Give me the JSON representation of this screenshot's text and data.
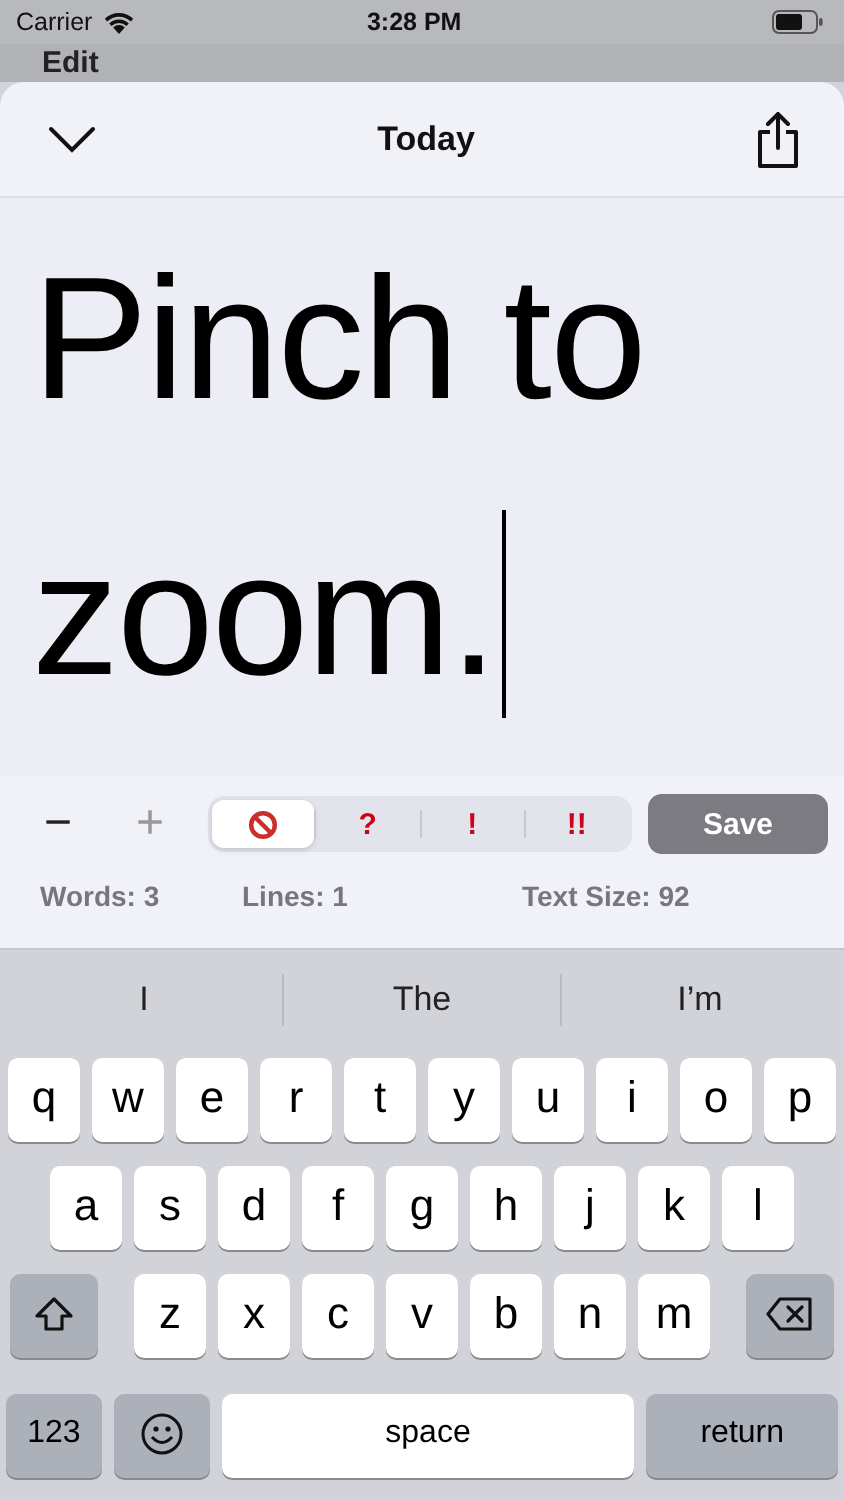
{
  "status_bar": {
    "carrier": "Carrier",
    "time": "3:28 PM"
  },
  "background_title": "Edit",
  "sheet": {
    "title": "Today"
  },
  "editor": {
    "text": "Pinch to zoom."
  },
  "toolbar": {
    "zoom_out": "−",
    "zoom_in": "+",
    "segments": [
      {
        "kind": "icon",
        "selected": true
      },
      {
        "kind": "text",
        "label": "?",
        "selected": false
      },
      {
        "kind": "text",
        "label": "!",
        "selected": false
      },
      {
        "kind": "text",
        "label": "!!",
        "selected": false
      }
    ],
    "save": "Save"
  },
  "stats": [
    "Words: 3",
    "Lines: 1",
    "Text Size: 92"
  ],
  "keyboard": {
    "suggestions": [
      "I",
      "The",
      "I’m"
    ],
    "rows": [
      [
        "q",
        "w",
        "e",
        "r",
        "t",
        "y",
        "u",
        "i",
        "o",
        "p"
      ],
      [
        "a",
        "s",
        "d",
        "f",
        "g",
        "h",
        "j",
        "k",
        "l"
      ],
      [
        "z",
        "x",
        "c",
        "v",
        "b",
        "n",
        "m"
      ]
    ],
    "numbers": "123",
    "space": "space",
    "return": "return"
  }
}
